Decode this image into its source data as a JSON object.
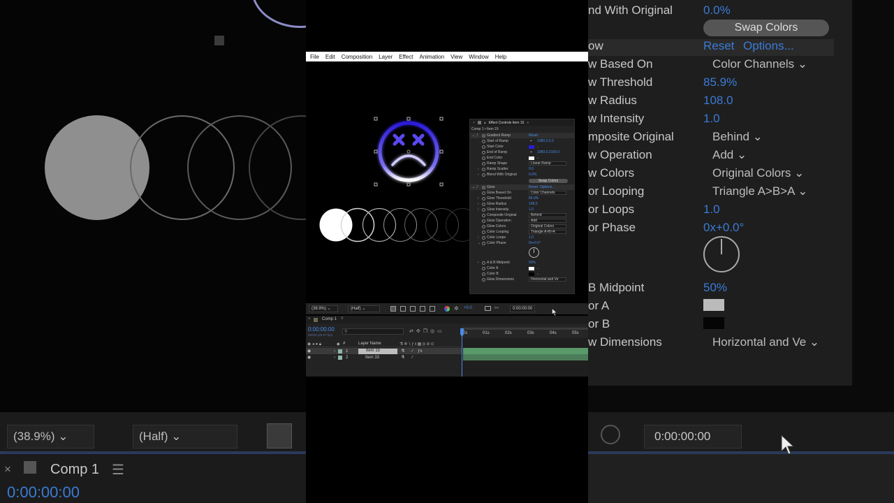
{
  "menu": [
    "File",
    "Edit",
    "Composition",
    "Layer",
    "Effect",
    "Animation",
    "View",
    "Window",
    "Help"
  ],
  "effect_controls": {
    "tab_title": "Effect Controls Item 15",
    "layer_path": "Comp 1 • Item 15",
    "gradient_ramp": {
      "name": "Gradient Ramp",
      "reset": "Reset",
      "start_of_ramp_label": "Start of Ramp",
      "start_of_ramp": "1080.0,0.0",
      "start_color_label": "Start Color",
      "start_color": "#2b1bd8",
      "end_of_ramp_label": "End of Ramp",
      "end_of_ramp": "1080.0,2160.0",
      "end_color_label": "End Color",
      "end_color": "#ffffff",
      "ramp_shape_label": "Ramp Shape",
      "ramp_shape": "Linear Ramp",
      "ramp_scatter_label": "Ramp Scatter",
      "ramp_scatter": "0.0",
      "blend_label": "Blend With Original",
      "blend": "0.0%",
      "swap_colors": "Swap Colors"
    },
    "glow": {
      "name": "Glow",
      "reset": "Reset",
      "options": "Options...",
      "based_on_label": "Glow Based On",
      "based_on": "Color Channels",
      "threshold_label": "Glow Threshold",
      "threshold": "85.9%",
      "radius_label": "Glow Radius",
      "radius": "108.0",
      "intensity_label": "Glow Intensity",
      "intensity": "1.0",
      "composite_label": "Composite Original",
      "composite": "Behind",
      "operation_label": "Glow Operation",
      "operation": "Add",
      "colors_label": "Glow Colors",
      "colors": "Original Colors",
      "looping_label": "Color Looping",
      "looping": "Triangle A>B>A",
      "loops_label": "Color Loops",
      "loops": "1.0",
      "phase_label": "Color Phase",
      "phase": "0x+0.0°",
      "midpoint_label": "A & B Midpoint",
      "midpoint": "50%",
      "color_a_label": "Color A",
      "color_a": "#ffffff",
      "color_b_label": "Color B",
      "color_b": "#000000",
      "dimensions_label": "Glow Dimensions",
      "dimensions": "Horizontal and Ve"
    }
  },
  "viewer": {
    "zoom": "(38.9%)",
    "resolution": "(Half)",
    "exposure": "+0.0",
    "timecode": "0:00:00:00"
  },
  "timeline": {
    "comp_tab": "Comp 1",
    "current_time": "0:00:00:00",
    "fps_info": "00000 (29.97 fps)",
    "search_placeholder": "",
    "layer_name_header": "Layer Name",
    "layers": [
      {
        "index": "1",
        "name": "Item 15"
      },
      {
        "index": "2",
        "name": "Item 33"
      }
    ],
    "ruler": [
      "0s",
      "01s",
      "02s",
      "03s",
      "04s",
      "05s"
    ]
  },
  "background_zoom": {
    "blend_label": "nd With Original",
    "blend_value": "0.0%",
    "swap_colors": "Swap Colors",
    "glow_label": "ow",
    "reset": "Reset",
    "options": "Options...",
    "based_on_label": "w Based On",
    "based_on": "Color Channels",
    "threshold_label": "w Threshold",
    "threshold": "85.9%",
    "radius_label": "w Radius",
    "radius": "108.0",
    "intensity_label": "w Intensity",
    "intensity": "1.0",
    "composite_label": "mposite Original",
    "composite": "Behind",
    "operation_label": "w Operation",
    "operation": "Add",
    "colors_label": "w Colors",
    "colors": "Original Colors",
    "looping_label": "or Looping",
    "looping": "Triangle A>B>A",
    "loops_label": "or Loops",
    "loops": "1.0",
    "phase_label": "or Phase",
    "phase": "0x+0.0°",
    "midpoint_label": "B Midpoint",
    "midpoint": "50%",
    "color_a_label": "or A",
    "color_b_label": "or B",
    "dimensions_label": "w Dimensions",
    "dimensions": "Horizontal and Ve",
    "zoom": "(38.9%)",
    "resolution": "(Half)",
    "timecode": "0:00:00:00",
    "comp_tab": "Comp 1",
    "current_time": "0:00:00:00"
  }
}
